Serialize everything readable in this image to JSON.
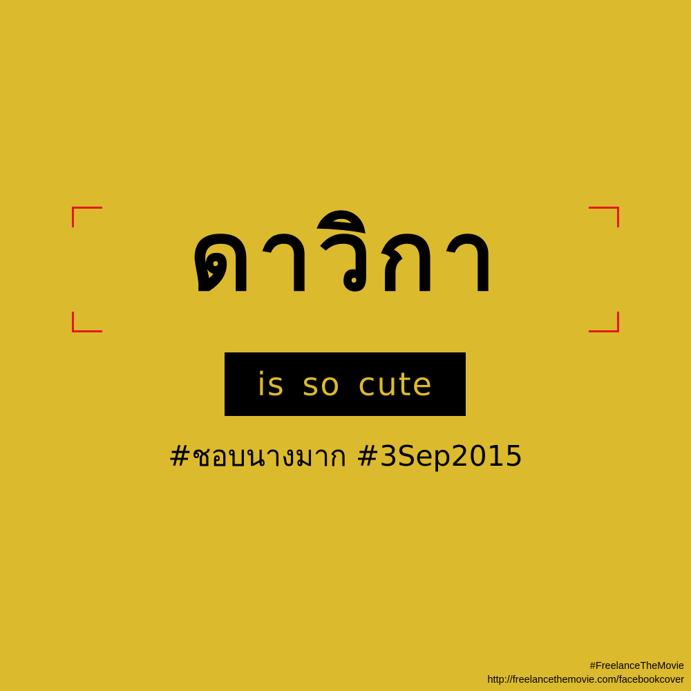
{
  "colors": {
    "background": "#dcba2d",
    "text": "#000000",
    "bracket": "#e21a1a",
    "tagline_box": "#000000",
    "tagline_text": "#dcba2d",
    "footer_text": "#000000"
  },
  "headline": "ดาวิกา",
  "tagline": "is so cute",
  "hashtags": "#ชอบนางมาก #3Sep2015",
  "footer": {
    "hashtag": "#FreelanceTheMovie",
    "url": "http://freelancethemovie.com/facebookcover"
  }
}
